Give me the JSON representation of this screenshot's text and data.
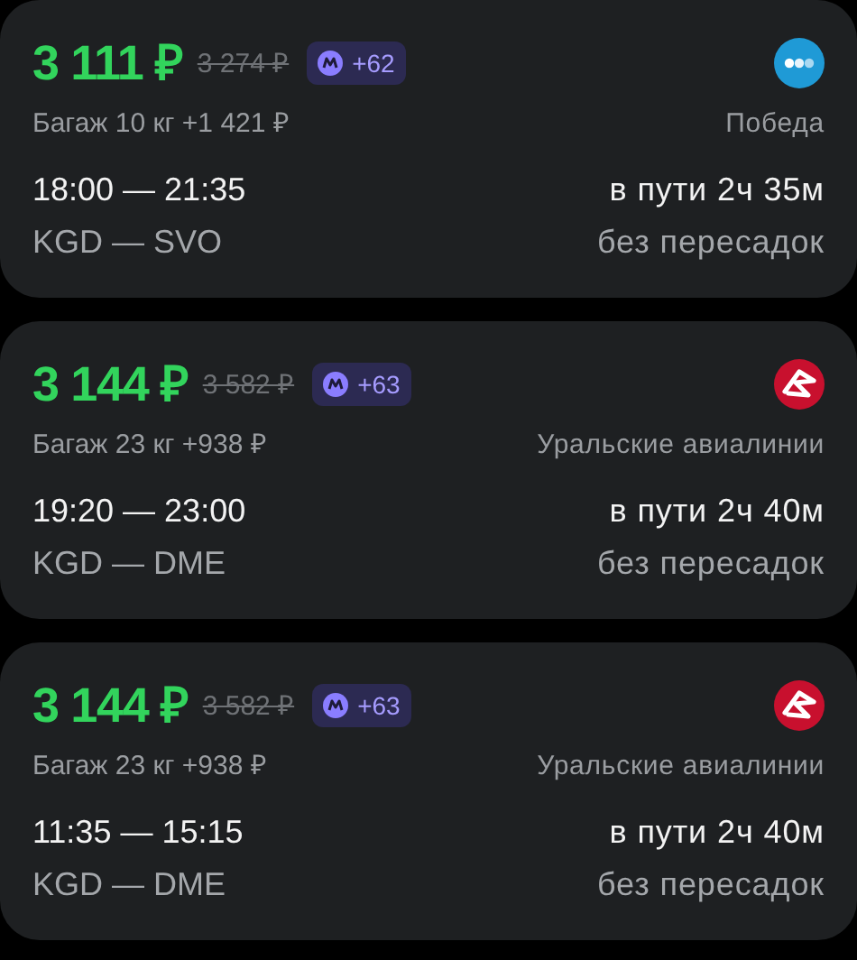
{
  "tickets": [
    {
      "price": "3 111 ₽",
      "old_price": "3 274 ₽",
      "bonus": "+62",
      "baggage": "Багаж 10 кг +1 421 ₽",
      "airline": "Победа",
      "kind": "dots",
      "times": "18:00 — 21:35",
      "duration": "в пути 2ч 35м",
      "route": "KGD — SVO",
      "transfers": "без пересадок"
    },
    {
      "price": "3 144 ₽",
      "old_price": "3 582 ₽",
      "bonus": "+63",
      "baggage": "Багаж 23 кг +938 ₽",
      "airline": "Уральские авиалинии",
      "kind": "swoosh",
      "times": "19:20 — 23:00",
      "duration": "в пути 2ч 40м",
      "route": "KGD — DME",
      "transfers": "без пересадок"
    },
    {
      "price": "3 144 ₽",
      "old_price": "3 582 ₽",
      "bonus": "+63",
      "baggage": "Багаж 23 кг +938 ₽",
      "airline": "Уральские авиалинии",
      "kind": "swoosh",
      "times": "11:35 — 15:15",
      "duration": "в пути 2ч 40м",
      "route": "KGD — DME",
      "transfers": "без пересадок"
    }
  ]
}
